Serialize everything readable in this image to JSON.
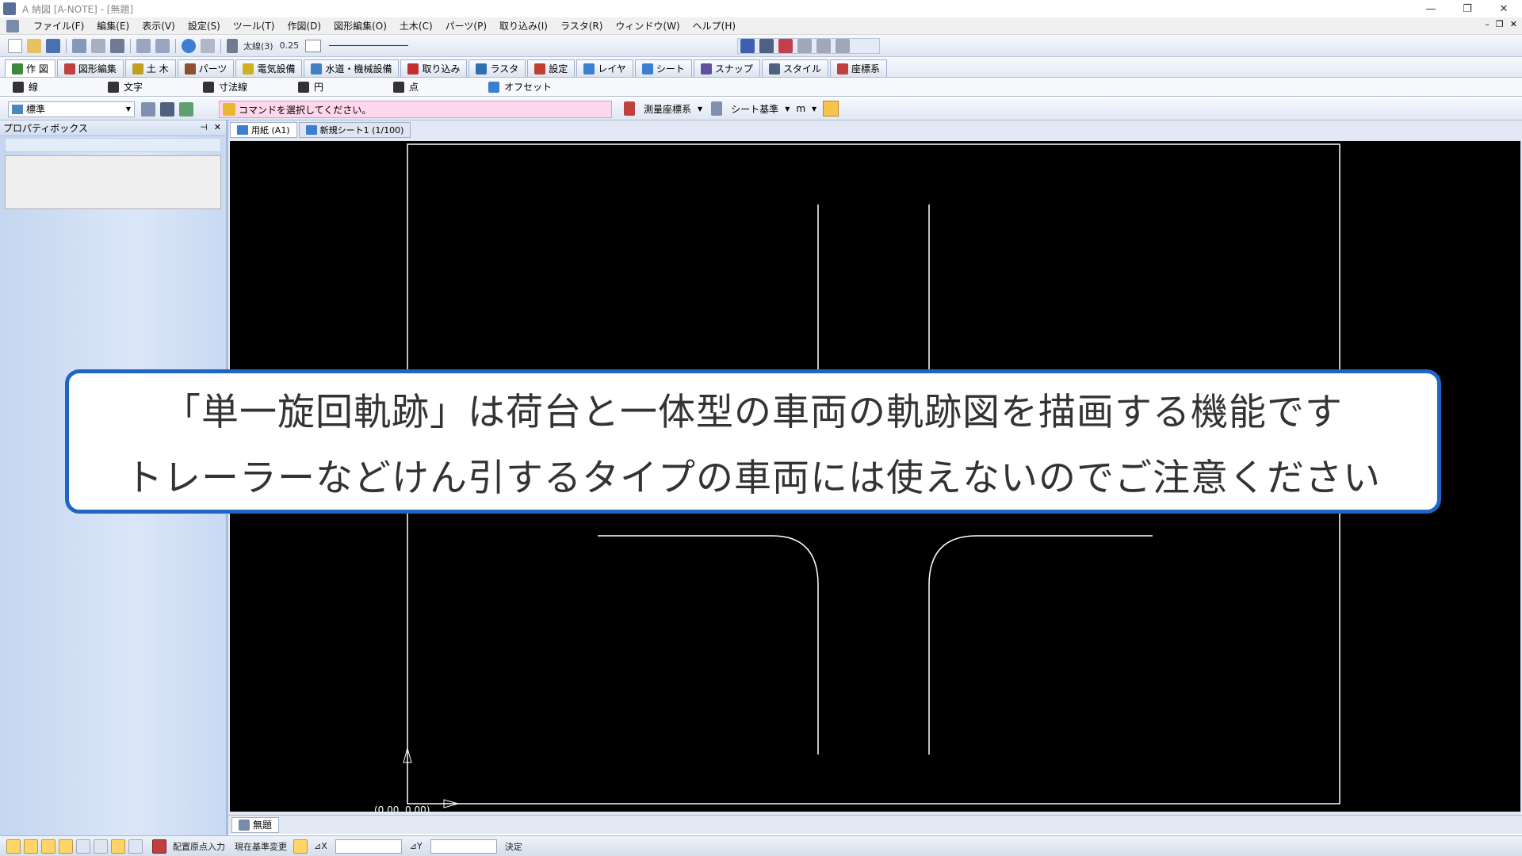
{
  "window": {
    "title": "A 納図 [A-NOTE] - [無題]",
    "controls": [
      "—",
      "❐",
      "✕"
    ]
  },
  "menu": {
    "items": [
      "ファイル(F)",
      "編集(E)",
      "表示(V)",
      "設定(S)",
      "ツール(T)",
      "作図(D)",
      "図形編集(O)",
      "土木(C)",
      "パーツ(P)",
      "取り込み(I)",
      "ラスタ(R)",
      "ウィンドウ(W)",
      "ヘルプ(H)"
    ],
    "mdi_controls": [
      "–",
      "❐",
      "✕"
    ]
  },
  "toolbar1": {
    "line_style_label": "太線(3)",
    "line_width_value": "0.25"
  },
  "ribbon_tabs": [
    {
      "label": "作 図",
      "color": "#3a8a3a"
    },
    {
      "label": "図形編集",
      "color": "#c04040"
    },
    {
      "label": "土 木",
      "color": "#c0a020"
    },
    {
      "label": "パーツ",
      "color": "#8a5030"
    },
    {
      "label": "電気設備",
      "color": "#d0b020"
    },
    {
      "label": "水道・機械設備",
      "color": "#4080c0"
    },
    {
      "label": "取り込み",
      "color": "#c03030"
    },
    {
      "label": "ラスタ",
      "color": "#3070b0"
    },
    {
      "label": "設定",
      "color": "#c04030"
    },
    {
      "label": "レイヤ",
      "color": "#3c7fd0"
    },
    {
      "label": "シート",
      "color": "#3c7fd0"
    },
    {
      "label": "スナップ",
      "color": "#6050a0"
    },
    {
      "label": "スタイル",
      "color": "#506080"
    },
    {
      "label": "座標系",
      "color": "#c04040"
    }
  ],
  "sub_tools": [
    {
      "label": "線",
      "color": "#333333"
    },
    {
      "label": "文字",
      "color": "#333333"
    },
    {
      "label": "寸法線",
      "color": "#333333"
    },
    {
      "label": "円",
      "color": "#333333"
    },
    {
      "label": "点",
      "color": "#333333"
    },
    {
      "label": "オフセット",
      "color": "#3c7fd0"
    }
  ],
  "command_bar": {
    "layer_value": "標準",
    "prompt": "コマンドを選択してください。",
    "survey_coord": "測量座標系",
    "sheet_base": "シート基準",
    "unit": "m"
  },
  "property_box": {
    "title": "プロパティボックス"
  },
  "doc_tabs": [
    {
      "label": "用紙 (A1)",
      "active": true
    },
    {
      "label": "新規シート1 (1/100)",
      "active": false
    }
  ],
  "drawing": {
    "origin_label": "(0.00, 0.00)",
    "line_color": "#ffffff",
    "background": "#000000"
  },
  "bottom_tab": {
    "label": "無題"
  },
  "statusbar": {
    "mode_text": "配置原点入力",
    "base_change": "現在基準変更",
    "dx_label": "⊿X",
    "dy_label": "⊿Y",
    "confirm": "決定"
  },
  "caption": {
    "line1": "「単一旋回軌跡」は荷台と一体型の車両の軌跡図を描画する機能です",
    "line2": "トレーラーなどけん引するタイプの車両には使えないのでご注意ください",
    "border_color": "#1f66c4"
  }
}
